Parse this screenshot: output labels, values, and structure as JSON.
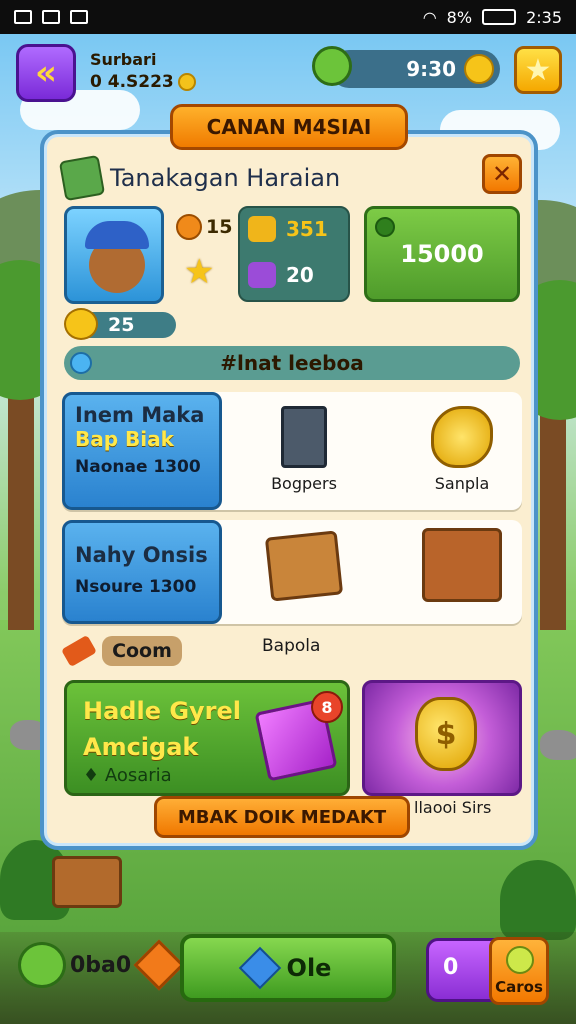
{
  "status_bar": {
    "battery": "8%",
    "time": "2:35"
  },
  "hud": {
    "player_name": "Surbari",
    "player_coins": "0 4.S223",
    "timer": "9:30"
  },
  "banner": {
    "label": "CANAN M4SIAI"
  },
  "panel": {
    "title": "Tanakagan Haraian",
    "stats": {
      "stat_a": "15",
      "stat_b": "351",
      "stat_c": "20",
      "currency_total": "15000",
      "level": "25"
    },
    "search": {
      "label": "#lnat leeboa"
    },
    "rows": [
      {
        "title": "Inem Maka",
        "subtitle": "Bap Biak",
        "price": "Naonae 1300",
        "items": [
          "Bogpers",
          "Sanpla"
        ]
      },
      {
        "title": "Nahy Onsis",
        "subtitle": "",
        "price": "Nsoure 1300",
        "items": [
          "",
          ""
        ]
      }
    ],
    "category": {
      "label": "Coom",
      "caption": "Bapola"
    },
    "green_card": {
      "title_line1": "Hadle Gyrel",
      "title_line2": "Amcigak",
      "subtitle": "Aosaria",
      "badge": "8"
    },
    "purple_card": {
      "caption": "llaooi Sirs",
      "glyph": "$"
    },
    "footer_button": {
      "label": "MBAK DOIK MEDAKT"
    }
  },
  "bottom_bar": {
    "left_label": "0ba0",
    "center_label": "Ole",
    "right_left_label": "0",
    "right_label": "Caros"
  },
  "icons": {
    "back": "back-arrow-icon",
    "star": "star-icon",
    "close": "close-icon"
  },
  "colors": {
    "panel_border": "#4c93c8",
    "accent_orange": "#f07b00",
    "accent_green": "#4f9c2b",
    "accent_purple": "#8a2ed4"
  }
}
